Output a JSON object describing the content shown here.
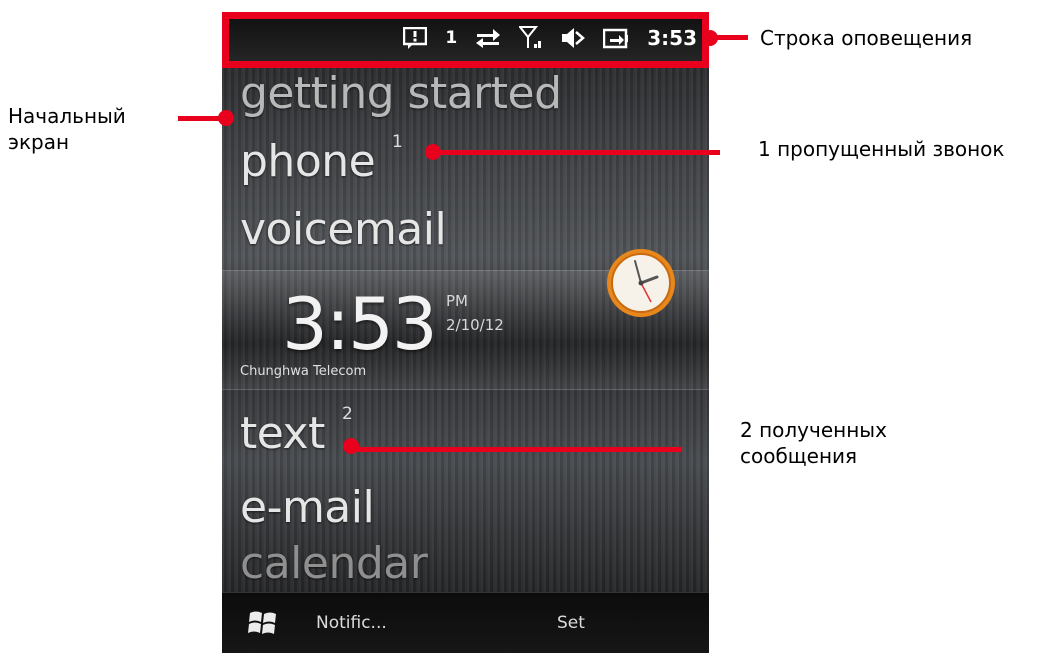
{
  "status_bar": {
    "notification_count": "1",
    "time": "3:53",
    "icons": [
      "message-icon",
      "data-sync-icon",
      "signal-icon",
      "speaker-muted-icon",
      "battery-charging-icon"
    ]
  },
  "home": {
    "items": {
      "getting_started": "getting started",
      "phone": "phone",
      "phone_badge": "1",
      "voicemail": "voicemail",
      "text": "text",
      "text_badge": "2",
      "email": "e-mail",
      "calendar": "calendar"
    },
    "clock": {
      "time": "3:53",
      "ampm": "PM",
      "date": "2/10/12",
      "carrier": "Chunghwa Telecom"
    }
  },
  "softkeys": {
    "left": "Notific...",
    "right": "Set"
  },
  "annotations": {
    "notification_bar": "Строка оповещения",
    "start_screen_line1": "Начальный",
    "start_screen_line2": "экран",
    "missed_call": "1 пропущенный звонок",
    "messages_line1": "2 полученных",
    "messages_line2": "сообщения",
    "accent_color": "#e8001c"
  }
}
